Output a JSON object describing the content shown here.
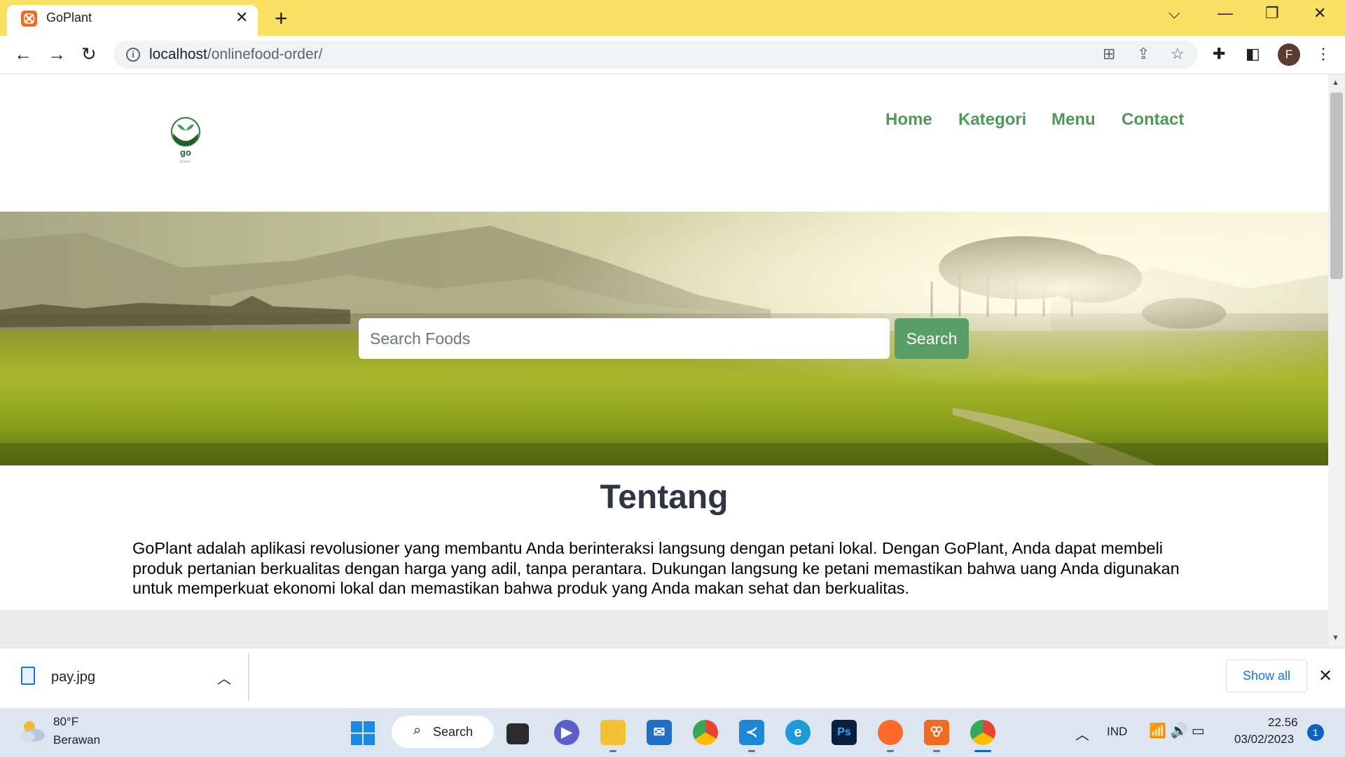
{
  "browser": {
    "tab_title": "GoPlant",
    "url_host": "localhost",
    "url_path": "/onlinefood-order/",
    "profile_initial": "F",
    "accent_color": "#fbe163"
  },
  "site": {
    "logo_text": "go",
    "logo_subtext": "plant",
    "nav": {
      "home": "Home",
      "kategori": "Kategori",
      "menu": "Menu",
      "contact": "Contact"
    },
    "search": {
      "placeholder": "Search Foods",
      "button_label": "Search"
    },
    "about": {
      "title": "Tentang",
      "text": "GoPlant adalah aplikasi revolusioner yang membantu Anda berinteraksi langsung dengan petani lokal. Dengan GoPlant, Anda dapat membeli produk pertanian berkualitas dengan harga yang adil, tanpa perantara. Dukungan langsung ke petani memastikan bahwa uang Anda digunakan untuk memperkuat ekonomi lokal dan memastikan bahwa produk yang Anda makan sehat dan berkualitas."
    },
    "brand_color": "#4f9a5a"
  },
  "downloads": {
    "file_name": "pay.jpg",
    "show_all_label": "Show all"
  },
  "taskbar": {
    "weather_temp": "80°F",
    "weather_desc": "Berawan",
    "search_label": "Search",
    "language": "IND",
    "time": "22.56",
    "date": "03/02/2023",
    "notification_count": "1",
    "apps": [
      "windows-start",
      "file-explorer-task",
      "teams-chat",
      "file-explorer",
      "mail",
      "chrome",
      "vscode",
      "edge",
      "photoshop",
      "firefox",
      "xampp",
      "chrome-profile"
    ]
  }
}
